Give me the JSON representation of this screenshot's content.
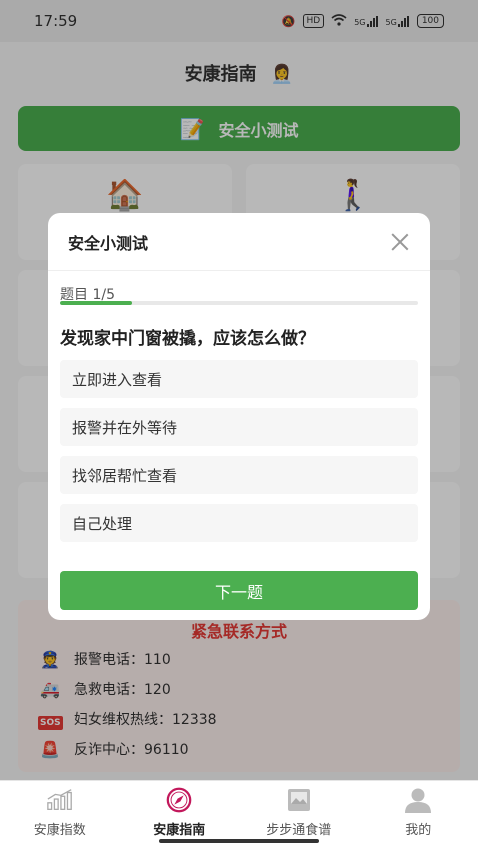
{
  "status_bar": {
    "time": "17:59",
    "hd_label": "HD",
    "signal1": "5G",
    "signal2": "5G",
    "battery": "100"
  },
  "header": {
    "title": "安康指南",
    "title_emoji": "👩‍💼"
  },
  "quiz_banner": {
    "emoji": "📝",
    "label": "安全小测试"
  },
  "cards": [
    {
      "emoji": "🏠"
    },
    {
      "emoji": "🚶‍♀️"
    }
  ],
  "emergency": {
    "title": "紧急联系方式",
    "items": [
      {
        "icon": "👮",
        "text": "报警电话：110"
      },
      {
        "icon": "🚑",
        "text": "急救电话：120"
      },
      {
        "icon": "SOS",
        "text": "妇女维权热线：12338"
      },
      {
        "icon": "🚨",
        "text": "反诈中心：96110"
      }
    ]
  },
  "modal": {
    "title": "安全小测试",
    "progress_label": "题目 1/5",
    "progress_fraction": 0.2,
    "question": "发现家中门窗被撬，应该怎么做？",
    "options": [
      "立即进入查看",
      "报警并在外等待",
      "找邻居帮忙查看",
      "自己处理"
    ],
    "next_label": "下一题"
  },
  "tabbar": {
    "items": [
      {
        "label": "安康指数",
        "icon": "bar-chart-icon"
      },
      {
        "label": "安康指南",
        "icon": "compass-icon",
        "active": true
      },
      {
        "label": "步步通食谱",
        "icon": "recipe-book-icon"
      },
      {
        "label": "我的",
        "icon": "user-icon"
      }
    ]
  },
  "colors": {
    "accent": "#4caf50",
    "emergency_red": "#e53935",
    "compass": "#c2185b"
  }
}
